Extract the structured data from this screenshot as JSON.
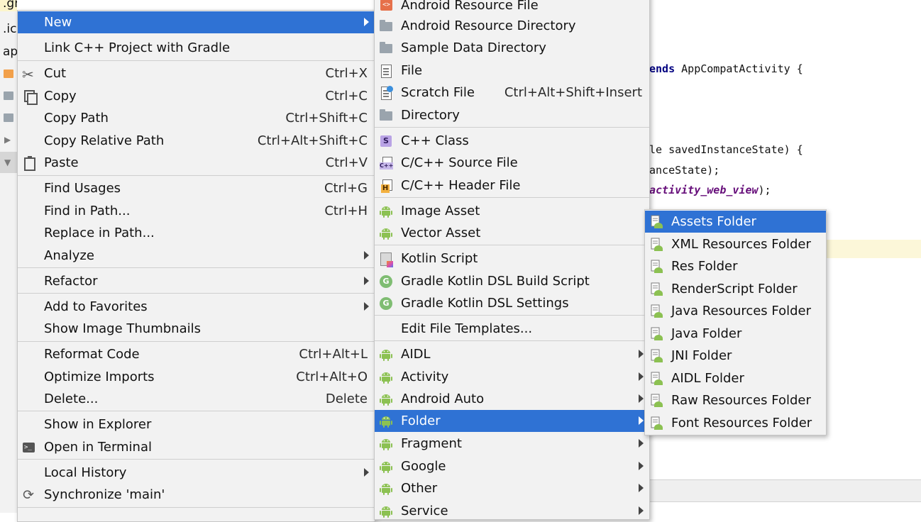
{
  "tree": {
    "items": [
      ".gradle",
      ".ic",
      "ap"
    ]
  },
  "editor": {
    "line1": "ends AppCompatActivity {",
    "line2": "le savedInstanceState) {",
    "line3": "anceState);",
    "line4_var": "activity_web_view",
    "line4_end": ");"
  },
  "main_menu": {
    "items": [
      {
        "label": "New",
        "submenu": true,
        "highlighted": true
      },
      {
        "label": "Link C++ Project with Gradle"
      },
      {
        "label": "Cut",
        "shortcut": "Ctrl+X",
        "icon": "scissors-icon"
      },
      {
        "label": "Copy",
        "shortcut": "Ctrl+C",
        "icon": "copy-icon"
      },
      {
        "label": "Copy Path",
        "shortcut": "Ctrl+Shift+C"
      },
      {
        "label": "Copy Relative Path",
        "shortcut": "Ctrl+Alt+Shift+C"
      },
      {
        "label": "Paste",
        "shortcut": "Ctrl+V",
        "icon": "paste-icon"
      },
      {
        "label": "Find Usages",
        "shortcut": "Ctrl+G"
      },
      {
        "label": "Find in Path...",
        "shortcut": "Ctrl+H"
      },
      {
        "label": "Replace in Path..."
      },
      {
        "label": "Analyze",
        "submenu": true
      },
      {
        "label": "Refactor",
        "submenu": true
      },
      {
        "label": "Add to Favorites",
        "submenu": true
      },
      {
        "label": "Show Image Thumbnails"
      },
      {
        "label": "Reformat Code",
        "shortcut": "Ctrl+Alt+L"
      },
      {
        "label": "Optimize Imports",
        "shortcut": "Ctrl+Alt+O"
      },
      {
        "label": "Delete...",
        "shortcut": "Delete"
      },
      {
        "label": "Show in Explorer"
      },
      {
        "label": "Open in Terminal",
        "icon": "terminal-icon"
      },
      {
        "label": "Local History",
        "submenu": true
      },
      {
        "label": "Synchronize 'main'",
        "icon": "sync-icon"
      }
    ]
  },
  "new_menu": {
    "items": [
      {
        "label": "Android Resource File",
        "icon": "android-resource-file-icon"
      },
      {
        "label": "Android Resource Directory",
        "icon": "folder-icon"
      },
      {
        "label": "Sample Data Directory",
        "icon": "folder-icon"
      },
      {
        "label": "File",
        "icon": "file-icon"
      },
      {
        "label": "Scratch File",
        "shortcut": "Ctrl+Alt+Shift+Insert",
        "icon": "scratch-file-icon"
      },
      {
        "label": "Directory",
        "icon": "folder-icon"
      },
      {
        "label": "C++ Class",
        "icon": "cpp-class-icon"
      },
      {
        "label": "C/C++ Source File",
        "icon": "cpp-source-icon"
      },
      {
        "label": "C/C++ Header File",
        "icon": "cpp-header-icon"
      },
      {
        "label": "Image Asset",
        "icon": "android-icon"
      },
      {
        "label": "Vector Asset",
        "icon": "android-icon"
      },
      {
        "label": "Kotlin Script",
        "icon": "kotlin-icon"
      },
      {
        "label": "Gradle Kotlin DSL Build Script",
        "icon": "gradle-icon"
      },
      {
        "label": "Gradle Kotlin DSL Settings",
        "icon": "gradle-icon"
      },
      {
        "label": "Edit File Templates..."
      },
      {
        "label": "AIDL",
        "submenu": true,
        "icon": "android-icon"
      },
      {
        "label": "Activity",
        "submenu": true,
        "icon": "android-icon"
      },
      {
        "label": "Android Auto",
        "submenu": true,
        "icon": "android-icon"
      },
      {
        "label": "Folder",
        "submenu": true,
        "icon": "android-icon",
        "highlighted": true
      },
      {
        "label": "Fragment",
        "submenu": true,
        "icon": "android-icon"
      },
      {
        "label": "Google",
        "submenu": true,
        "icon": "android-icon"
      },
      {
        "label": "Other",
        "submenu": true,
        "icon": "android-icon"
      },
      {
        "label": "Service",
        "submenu": true,
        "icon": "android-icon"
      }
    ]
  },
  "folder_menu": {
    "items": [
      {
        "label": "Assets Folder",
        "highlighted": true
      },
      {
        "label": "XML Resources Folder"
      },
      {
        "label": "Res Folder"
      },
      {
        "label": "RenderScript Folder"
      },
      {
        "label": "Java Resources Folder"
      },
      {
        "label": "Java Folder"
      },
      {
        "label": "JNI Folder"
      },
      {
        "label": "AIDL Folder"
      },
      {
        "label": "Raw Resources Folder"
      },
      {
        "label": "Font Resources Folder"
      }
    ]
  },
  "colors": {
    "highlight": "#2f72d4",
    "menu_bg": "#f2f2f2",
    "android_green": "#8cc152"
  }
}
